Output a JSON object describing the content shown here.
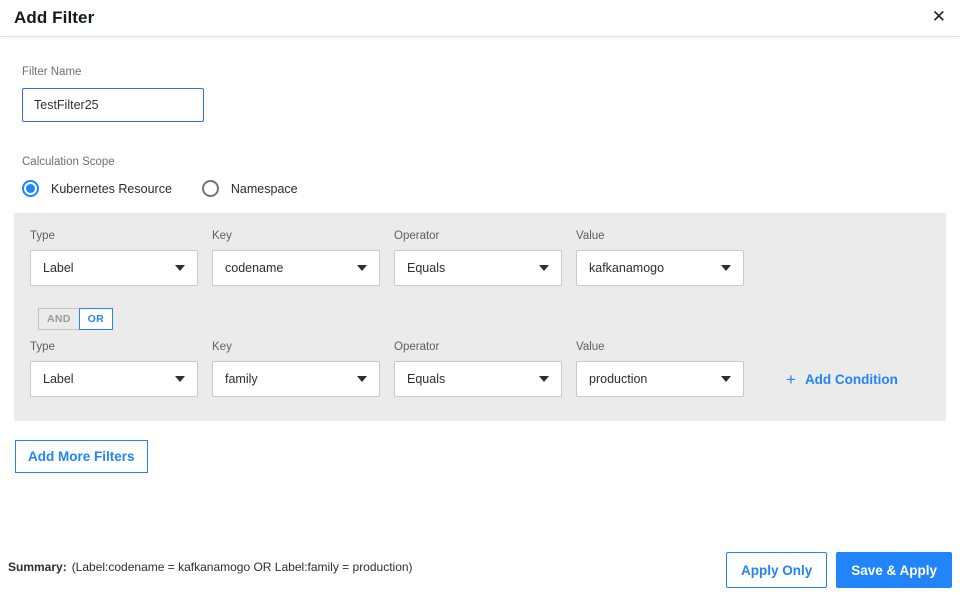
{
  "header": {
    "title": "Add Filter",
    "close_icon": "✕"
  },
  "filter_name": {
    "label": "Filter Name",
    "value": "TestFilter25"
  },
  "calculation_scope": {
    "label": "Calculation Scope",
    "options": [
      {
        "label": "Kubernetes Resource",
        "selected": true
      },
      {
        "label": "Namespace",
        "selected": false
      }
    ]
  },
  "conditions": {
    "columns": [
      "Type",
      "Key",
      "Operator",
      "Value"
    ],
    "rows": [
      {
        "type": "Label",
        "key": "codename",
        "operator": "Equals",
        "value": "kafkanamogo"
      },
      {
        "type": "Label",
        "key": "family",
        "operator": "Equals",
        "value": "production"
      }
    ],
    "join": {
      "and_label": "AND",
      "or_label": "OR",
      "selected": "OR"
    },
    "add_condition": {
      "plus_icon": "+",
      "label": "Add Condition"
    }
  },
  "add_more_filters_label": "Add More Filters",
  "footer": {
    "summary_label": "Summary:",
    "summary_text": "(Label:codename = kafkanamogo OR Label:family = production)",
    "apply_only_label": "Apply Only",
    "save_apply_label": "Save & Apply"
  },
  "colors": {
    "accent": "#2184f8",
    "panel_background": "#ebebeb",
    "input_border": "#2d6ff2"
  }
}
